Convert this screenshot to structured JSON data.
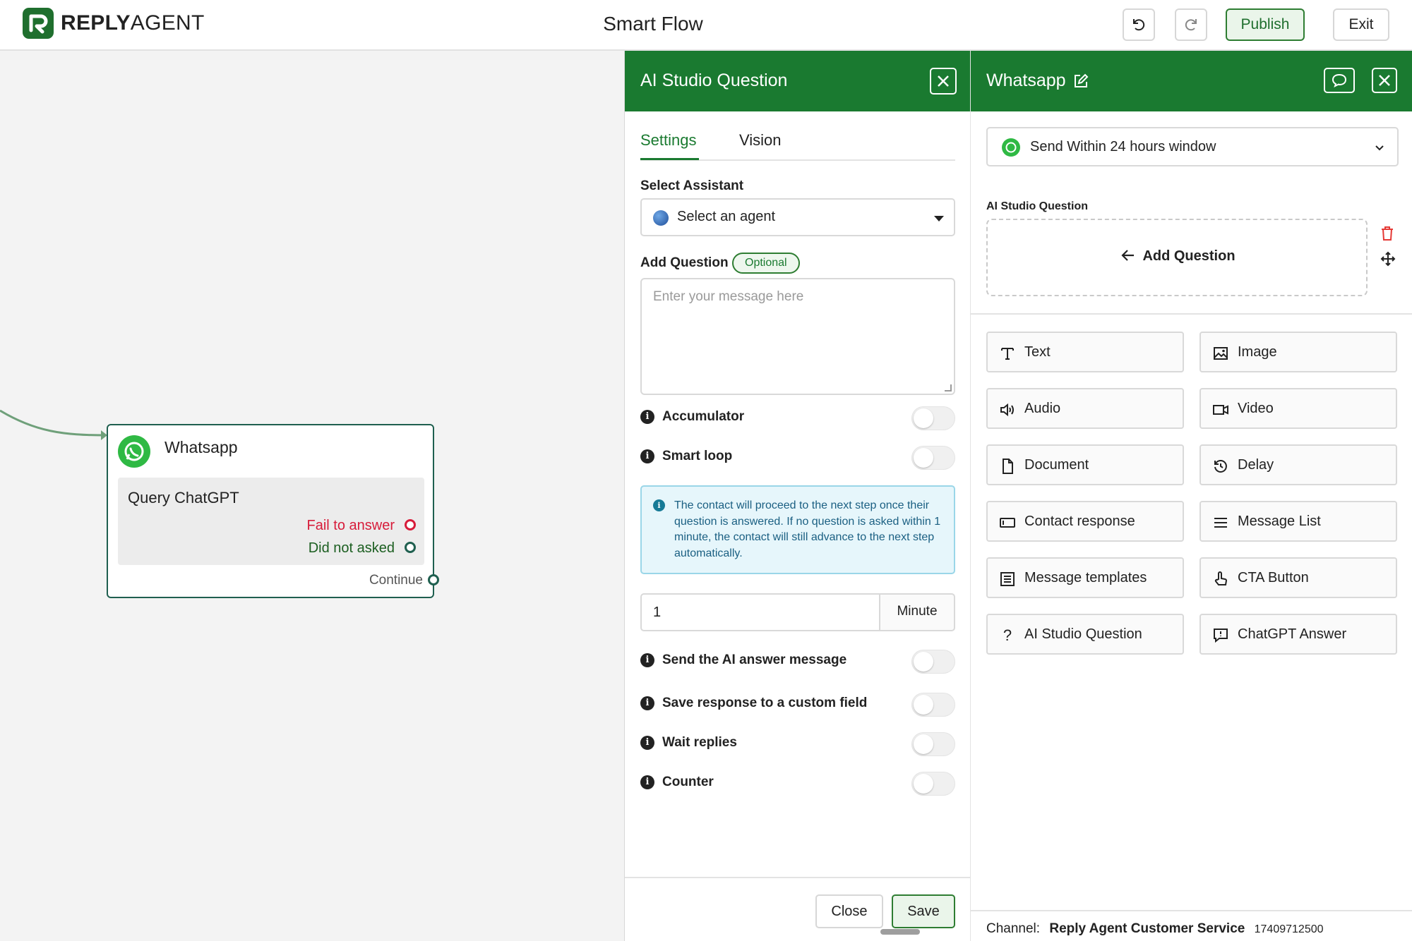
{
  "app": {
    "logo_bold": "REPLY",
    "logo_light": "AGENT",
    "page_title": "Smart Flow"
  },
  "toolbar": {
    "undo_icon": "undo-icon",
    "redo_icon": "redo-icon",
    "publish_label": "Publish",
    "exit_label": "Exit"
  },
  "canvas": {
    "node": {
      "title": "Whatsapp",
      "query": "Query ChatGPT",
      "fail_label": "Fail to answer",
      "not_asked_label": "Did not asked",
      "continue_label": "Continue"
    }
  },
  "ai_panel": {
    "title": "AI Studio Question",
    "tabs": [
      "Settings",
      "Vision"
    ],
    "active_tab": "Settings",
    "select_assistant_label": "Select Assistant",
    "select_assistant_value": "Select an agent",
    "add_question_label": "Add Question",
    "optional_badge": "Optional",
    "message_placeholder": "Enter your message here",
    "toggles": [
      {
        "label": "Accumulator",
        "on": false
      },
      {
        "label": "Smart loop",
        "on": false
      },
      {
        "label": "Send the AI answer message",
        "on": false
      },
      {
        "label": "Save response to a custom field",
        "on": false
      },
      {
        "label": "Wait replies",
        "on": false
      },
      {
        "label": "Counter",
        "on": false
      }
    ],
    "note": "The contact will proceed to the next step once their question is answered. If no question is asked within 1 minute, the contact will still advance to the next step automatically.",
    "timeout_value": "1",
    "timeout_unit": "Minute",
    "close_label": "Close",
    "save_label": "Save"
  },
  "wa_panel": {
    "title": "Whatsapp",
    "send_window": "Send Within 24 hours window",
    "section_label": "AI Studio Question",
    "add_question": "Add Question",
    "tiles": [
      {
        "label": "Text",
        "icon": "text-icon"
      },
      {
        "label": "Image",
        "icon": "image-icon"
      },
      {
        "label": "Audio",
        "icon": "audio-icon"
      },
      {
        "label": "Video",
        "icon": "video-icon"
      },
      {
        "label": "Document",
        "icon": "document-icon"
      },
      {
        "label": "Delay",
        "icon": "delay-icon"
      },
      {
        "label": "Contact response",
        "icon": "contact-response-icon"
      },
      {
        "label": "Message List",
        "icon": "list-icon"
      },
      {
        "label": "Message templates",
        "icon": "template-icon"
      },
      {
        "label": "CTA Button",
        "icon": "pointer-icon"
      },
      {
        "label": "AI Studio Question",
        "icon": "question-icon"
      },
      {
        "label": "ChatGPT Answer",
        "icon": "chat-answer-icon"
      }
    ],
    "channel_label": "Channel:",
    "channel_name": "Reply Agent Customer Service",
    "channel_number": "17409712500"
  },
  "colors": {
    "brand_green": "#1a7a30",
    "error_red": "#d71c3a",
    "info_blue": "#1a5f82"
  }
}
